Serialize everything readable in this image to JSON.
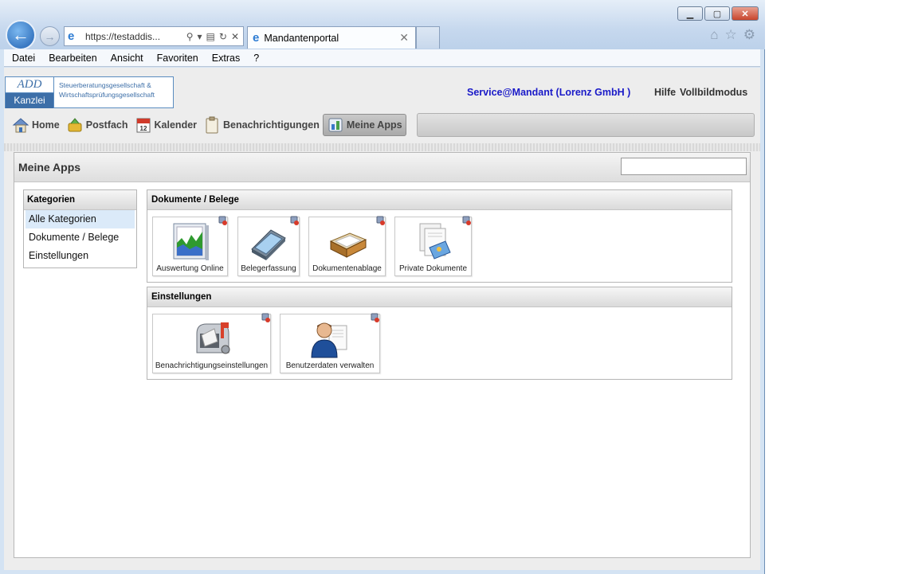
{
  "browser": {
    "address": "https://testaddis...",
    "tab_title": "Mandantenportal",
    "menu": [
      "Datei",
      "Bearbeiten",
      "Ansicht",
      "Favoriten",
      "Extras",
      "?"
    ]
  },
  "header": {
    "logo_top": "ADD",
    "logo_bottom": "Kanzlei",
    "logo_line1": "Steuerberatungsgesellschaft &",
    "logo_line2": "Wirtschaftsprüfungsgesellschaft",
    "service": "Service@Mandant (Lorenz GmbH )",
    "help": "Hilfe",
    "fullscreen": "Vollbildmodus"
  },
  "nav": {
    "items": [
      {
        "label": "Home",
        "icon": "house-icon"
      },
      {
        "label": "Postfach",
        "icon": "mailbox-icon"
      },
      {
        "label": "Kalender",
        "icon": "calendar-icon"
      },
      {
        "label": "Benachrichtigungen",
        "icon": "clipboard-icon"
      },
      {
        "label": "Meine Apps",
        "icon": "apps-icon"
      }
    ],
    "active": "Meine Apps"
  },
  "panel": {
    "title": "Meine Apps",
    "search_value": ""
  },
  "categories": {
    "title": "Kategorien",
    "items": [
      "Alle Kategorien",
      "Dokumente / Belege",
      "Einstellungen"
    ],
    "selected": "Alle Kategorien"
  },
  "groups": [
    {
      "title": "Dokumente / Belege",
      "apps": [
        {
          "label": "Auswertung Online",
          "icon": "chart-icon"
        },
        {
          "label": "Belegerfassung",
          "icon": "scanner-icon"
        },
        {
          "label": "Dokumentenablage",
          "icon": "tray-icon"
        },
        {
          "label": "Private Dokumente",
          "icon": "documents-icon"
        }
      ]
    },
    {
      "title": "Einstellungen",
      "apps": [
        {
          "label": "Benachrichtigungseinstellungen",
          "icon": "mailbox-settings-icon"
        },
        {
          "label": "Benutzerdaten verwalten",
          "icon": "user-icon"
        }
      ]
    }
  ]
}
